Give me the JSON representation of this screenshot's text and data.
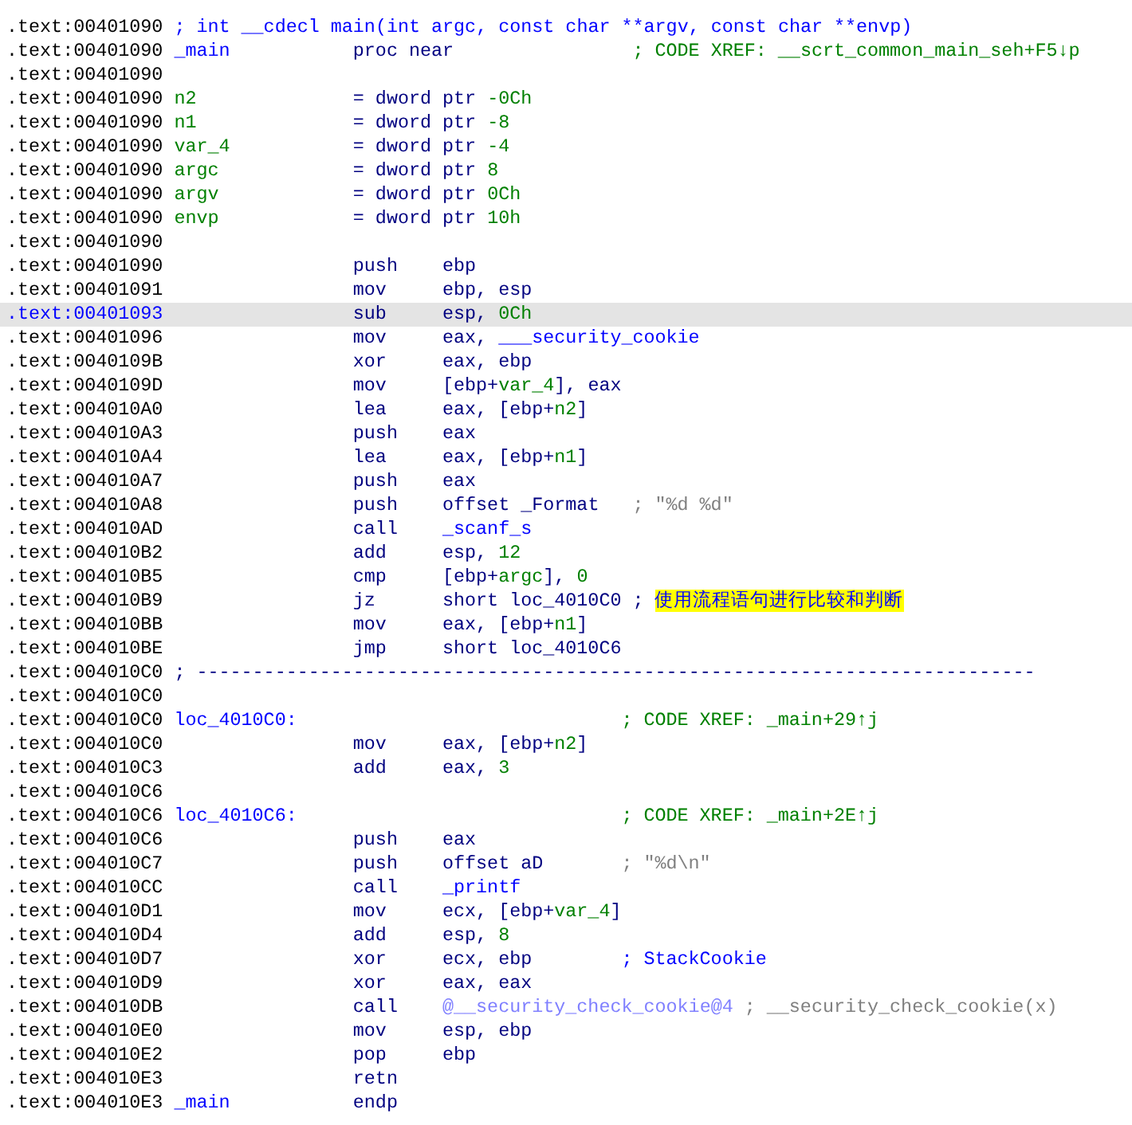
{
  "lines": [
    {
      "address": ".text:00401090",
      "kind": "note",
      "selected": false,
      "comment": [
        {
          "text": "; int __cdecl main(int argc, const char **argv, const char **envp)",
          "kind": "name"
        }
      ]
    },
    {
      "address": ".text:00401090",
      "kind": "code",
      "selected": false,
      "label": {
        "text": "_main",
        "kind": "name"
      },
      "mnemonic": "proc near",
      "comment": [
        {
          "text": "; CODE XREF: __scrt_common_main_seh+F5↓p",
          "kind": "comment"
        }
      ]
    },
    {
      "address": ".text:00401090",
      "kind": "code",
      "selected": false
    },
    {
      "address": ".text:00401090",
      "kind": "stackvar",
      "selected": false,
      "label": {
        "text": "n2",
        "kind": "var"
      },
      "mnemonic": "= dword ptr",
      "operands": [
        {
          "text": "-0Ch",
          "kind": "const"
        }
      ]
    },
    {
      "address": ".text:00401090",
      "kind": "stackvar",
      "selected": false,
      "label": {
        "text": "n1",
        "kind": "var"
      },
      "mnemonic": "= dword ptr",
      "operands": [
        {
          "text": "-8",
          "kind": "const"
        }
      ]
    },
    {
      "address": ".text:00401090",
      "kind": "stackvar",
      "selected": false,
      "label": {
        "text": "var_4",
        "kind": "var"
      },
      "mnemonic": "= dword ptr",
      "operands": [
        {
          "text": "-4",
          "kind": "const"
        }
      ]
    },
    {
      "address": ".text:00401090",
      "kind": "stackvar",
      "selected": false,
      "label": {
        "text": "argc",
        "kind": "var"
      },
      "mnemonic": "= dword ptr",
      "operands": [
        {
          "text": "8",
          "kind": "const"
        }
      ]
    },
    {
      "address": ".text:00401090",
      "kind": "stackvar",
      "selected": false,
      "label": {
        "text": "argv",
        "kind": "var"
      },
      "mnemonic": "= dword ptr",
      "operands": [
        {
          "text": "0Ch",
          "kind": "const"
        }
      ]
    },
    {
      "address": ".text:00401090",
      "kind": "stackvar",
      "selected": false,
      "label": {
        "text": "envp",
        "kind": "var"
      },
      "mnemonic": "= dword ptr",
      "operands": [
        {
          "text": "10h",
          "kind": "const"
        }
      ]
    },
    {
      "address": ".text:00401090",
      "kind": "code",
      "selected": false
    },
    {
      "address": ".text:00401090",
      "kind": "code",
      "selected": false,
      "mnemonic": "push",
      "operands": [
        {
          "text": "ebp",
          "kind": "plain"
        }
      ]
    },
    {
      "address": ".text:00401091",
      "kind": "code",
      "selected": false,
      "mnemonic": "mov",
      "operands": [
        {
          "text": "ebp, esp",
          "kind": "plain"
        }
      ]
    },
    {
      "address": ".text:00401093",
      "kind": "code",
      "selected": true,
      "mnemonic": "sub",
      "operands": [
        {
          "text": "esp, ",
          "kind": "plain"
        },
        {
          "text": "0Ch",
          "kind": "const"
        }
      ]
    },
    {
      "address": ".text:00401096",
      "kind": "code",
      "selected": false,
      "mnemonic": "mov",
      "operands": [
        {
          "text": "eax, ",
          "kind": "plain"
        },
        {
          "text": "___security_cookie",
          "kind": "name"
        }
      ]
    },
    {
      "address": ".text:0040109B",
      "kind": "code",
      "selected": false,
      "mnemonic": "xor",
      "operands": [
        {
          "text": "eax, ebp",
          "kind": "plain"
        }
      ]
    },
    {
      "address": ".text:0040109D",
      "kind": "code",
      "selected": false,
      "mnemonic": "mov",
      "operands": [
        {
          "text": "[ebp+",
          "kind": "plain"
        },
        {
          "text": "var_4",
          "kind": "const"
        },
        {
          "text": "], eax",
          "kind": "plain"
        }
      ]
    },
    {
      "address": ".text:004010A0",
      "kind": "code",
      "selected": false,
      "mnemonic": "lea",
      "operands": [
        {
          "text": "eax, [ebp+",
          "kind": "plain"
        },
        {
          "text": "n2",
          "kind": "const"
        },
        {
          "text": "]",
          "kind": "plain"
        }
      ]
    },
    {
      "address": ".text:004010A3",
      "kind": "code",
      "selected": false,
      "mnemonic": "push",
      "operands": [
        {
          "text": "eax",
          "kind": "plain"
        }
      ]
    },
    {
      "address": ".text:004010A4",
      "kind": "code",
      "selected": false,
      "mnemonic": "lea",
      "operands": [
        {
          "text": "eax, [ebp+",
          "kind": "plain"
        },
        {
          "text": "n1",
          "kind": "const"
        },
        {
          "text": "]",
          "kind": "plain"
        }
      ]
    },
    {
      "address": ".text:004010A7",
      "kind": "code",
      "selected": false,
      "mnemonic": "push",
      "operands": [
        {
          "text": "eax",
          "kind": "plain"
        }
      ]
    },
    {
      "address": ".text:004010A8",
      "kind": "code",
      "selected": false,
      "mnemonic": "push",
      "operands": [
        {
          "text": "offset ",
          "kind": "plain"
        },
        {
          "text": "_Format",
          "kind": "plain"
        }
      ],
      "comment": [
        {
          "text": " ; \"%d %d\"",
          "kind": "string"
        }
      ]
    },
    {
      "address": ".text:004010AD",
      "kind": "code",
      "selected": false,
      "mnemonic": "call",
      "operands": [
        {
          "text": "_scanf_s",
          "kind": "name"
        }
      ]
    },
    {
      "address": ".text:004010B2",
      "kind": "code",
      "selected": false,
      "mnemonic": "add",
      "operands": [
        {
          "text": "esp, ",
          "kind": "plain"
        },
        {
          "text": "12",
          "kind": "const"
        }
      ]
    },
    {
      "address": ".text:004010B5",
      "kind": "code",
      "selected": false,
      "mnemonic": "cmp",
      "operands": [
        {
          "text": "[ebp+",
          "kind": "plain"
        },
        {
          "text": "argc",
          "kind": "const"
        },
        {
          "text": "], ",
          "kind": "plain"
        },
        {
          "text": "0",
          "kind": "const"
        }
      ]
    },
    {
      "address": ".text:004010B9",
      "kind": "code",
      "selected": false,
      "mnemonic": "jz",
      "operands": [
        {
          "text": "short loc_4010C0",
          "kind": "plain"
        }
      ],
      "comment": [
        {
          "text": ";",
          "kind": "plain"
        },
        {
          "text": "使用流程语句进行比较和判断",
          "kind": "highlight"
        }
      ]
    },
    {
      "address": ".text:004010BB",
      "kind": "code",
      "selected": false,
      "mnemonic": "mov",
      "operands": [
        {
          "text": "eax, [ebp+",
          "kind": "plain"
        },
        {
          "text": "n1",
          "kind": "const"
        },
        {
          "text": "]",
          "kind": "plain"
        }
      ]
    },
    {
      "address": ".text:004010BE",
      "kind": "code",
      "selected": false,
      "mnemonic": "jmp",
      "operands": [
        {
          "text": "short loc_4010C6",
          "kind": "plain"
        }
      ]
    },
    {
      "address": ".text:004010C0",
      "kind": "note",
      "selected": false,
      "comment": [
        {
          "text": "; ---------------------------------------------------------------------------",
          "kind": "plain"
        }
      ]
    },
    {
      "address": ".text:004010C0",
      "kind": "code",
      "selected": false
    },
    {
      "address": ".text:004010C0",
      "kind": "code",
      "selected": false,
      "label": {
        "text": "loc_4010C0:",
        "kind": "name"
      },
      "comment": [
        {
          "text": "; CODE XREF: _main+29↑j",
          "kind": "comment"
        }
      ]
    },
    {
      "address": ".text:004010C0",
      "kind": "code",
      "selected": false,
      "mnemonic": "mov",
      "operands": [
        {
          "text": "eax, [ebp+",
          "kind": "plain"
        },
        {
          "text": "n2",
          "kind": "const"
        },
        {
          "text": "]",
          "kind": "plain"
        }
      ]
    },
    {
      "address": ".text:004010C3",
      "kind": "code",
      "selected": false,
      "mnemonic": "add",
      "operands": [
        {
          "text": "eax, ",
          "kind": "plain"
        },
        {
          "text": "3",
          "kind": "const"
        }
      ]
    },
    {
      "address": ".text:004010C6",
      "kind": "code",
      "selected": false
    },
    {
      "address": ".text:004010C6",
      "kind": "code",
      "selected": false,
      "label": {
        "text": "loc_4010C6:",
        "kind": "name"
      },
      "comment": [
        {
          "text": "; CODE XREF: _main+2E↑j",
          "kind": "comment"
        }
      ]
    },
    {
      "address": ".text:004010C6",
      "kind": "code",
      "selected": false,
      "mnemonic": "push",
      "operands": [
        {
          "text": "eax",
          "kind": "plain"
        }
      ]
    },
    {
      "address": ".text:004010C7",
      "kind": "code",
      "selected": false,
      "mnemonic": "push",
      "operands": [
        {
          "text": "offset aD",
          "kind": "plain"
        }
      ],
      "comment": [
        {
          "text": "; \"%d\\n\"",
          "kind": "string"
        }
      ]
    },
    {
      "address": ".text:004010CC",
      "kind": "code",
      "selected": false,
      "mnemonic": "call",
      "operands": [
        {
          "text": "_printf",
          "kind": "name"
        }
      ]
    },
    {
      "address": ".text:004010D1",
      "kind": "code",
      "selected": false,
      "mnemonic": "mov",
      "operands": [
        {
          "text": "ecx, [ebp+",
          "kind": "plain"
        },
        {
          "text": "var_4",
          "kind": "const"
        },
        {
          "text": "]",
          "kind": "plain"
        }
      ]
    },
    {
      "address": ".text:004010D4",
      "kind": "code",
      "selected": false,
      "mnemonic": "add",
      "operands": [
        {
          "text": "esp, ",
          "kind": "plain"
        },
        {
          "text": "8",
          "kind": "const"
        }
      ]
    },
    {
      "address": ".text:004010D7",
      "kind": "code",
      "selected": false,
      "mnemonic": "xor",
      "operands": [
        {
          "text": "ecx, ebp",
          "kind": "plain"
        }
      ],
      "comment": [
        {
          "text": "; StackCookie",
          "kind": "name"
        }
      ]
    },
    {
      "address": ".text:004010D9",
      "kind": "code",
      "selected": false,
      "mnemonic": "xor",
      "operands": [
        {
          "text": "eax, eax",
          "kind": "plain"
        }
      ]
    },
    {
      "address": ".text:004010DB",
      "kind": "code",
      "selected": false,
      "mnemonic": "call",
      "operands": [
        {
          "text": "@__security_check_cookie@4",
          "kind": "import"
        }
      ],
      "comment": [
        {
          "text": "; __security_check_cookie(x)",
          "kind": "string"
        }
      ]
    },
    {
      "address": ".text:004010E0",
      "kind": "code",
      "selected": false,
      "mnemonic": "mov",
      "operands": [
        {
          "text": "esp, ebp",
          "kind": "plain"
        }
      ]
    },
    {
      "address": ".text:004010E2",
      "kind": "code",
      "selected": false,
      "mnemonic": "pop",
      "operands": [
        {
          "text": "ebp",
          "kind": "plain"
        }
      ]
    },
    {
      "address": ".text:004010E3",
      "kind": "code",
      "selected": false,
      "mnemonic": "retn"
    },
    {
      "address": ".text:004010E3",
      "kind": "code",
      "selected": false,
      "label": {
        "text": "_main",
        "kind": "name"
      },
      "mnemonic": "endp"
    }
  ]
}
